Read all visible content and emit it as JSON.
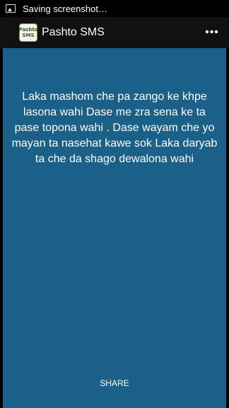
{
  "status_bar": {
    "notification_icon": "image-icon",
    "text": "Saving screenshot…"
  },
  "action_bar": {
    "app_icon_text_line1": "Pashto",
    "app_icon_text_line2": "SMS",
    "title": "Pashto SMS",
    "overflow_icon": "overflow-menu-icon",
    "overflow_glyph": "•••"
  },
  "content": {
    "sms_text": "Laka mashom che pa zango ke khpe lasona wahi Dase me zra sena ke ta pase topona wahi . Dase wayam che yo mayan ta nasehat kawe sok Laka daryab ta che da shago dewalona wahi",
    "share_label": "SHARE",
    "background_color": "#1b6089"
  }
}
